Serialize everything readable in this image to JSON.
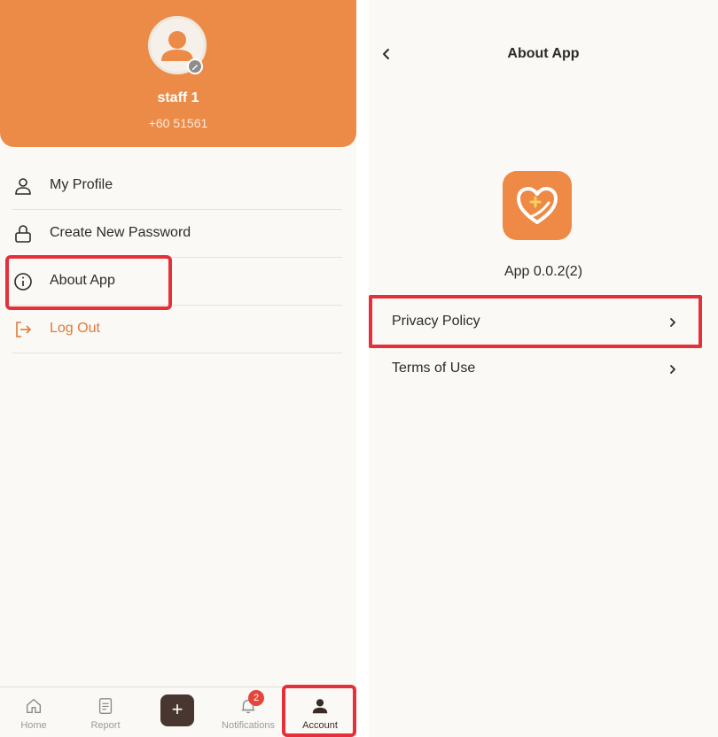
{
  "left": {
    "profile": {
      "name": "staff 1",
      "phone": "+60 51561"
    },
    "menu": [
      {
        "label": "My Profile",
        "icon": "user-icon"
      },
      {
        "label": "Create New Password",
        "icon": "lock-icon"
      },
      {
        "label": "About App",
        "icon": "info-icon"
      },
      {
        "label": "Log Out",
        "icon": "logout-icon"
      }
    ],
    "tabs": [
      {
        "label": "Home",
        "icon": "home-icon"
      },
      {
        "label": "Report",
        "icon": "document-icon"
      },
      {
        "label": "",
        "icon": "plus-icon",
        "symbol": "+"
      },
      {
        "label": "Notifications",
        "icon": "bell-icon",
        "badge": "2"
      },
      {
        "label": "Account",
        "icon": "account-icon"
      }
    ]
  },
  "right": {
    "title": "About App",
    "version": "App 0.0.2(2)",
    "links": [
      {
        "label": "Privacy Policy"
      },
      {
        "label": "Terms of Use"
      }
    ]
  },
  "colors": {
    "accent": "#ec8b47",
    "logout": "#e07b39",
    "highlight": "#e5303a",
    "add_button": "#4a3630",
    "badge": "#e5453a"
  }
}
